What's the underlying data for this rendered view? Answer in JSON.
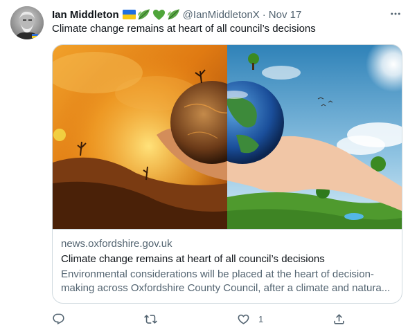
{
  "tweet": {
    "author_name": "Ian Middleton",
    "handle": "@IanMiddletonX",
    "separator": "·",
    "date": "Nov 17",
    "text": "Climate change remains at heart of all council’s decisions",
    "badge_icons": [
      "ukraine-flag-icon",
      "leaf-icon",
      "green-heart-icon",
      "leaf-icon"
    ]
  },
  "card": {
    "domain": "news.oxfordshire.gov.uk",
    "title": "Climate change remains at heart of all council’s decisions",
    "description": "Environmental considerations will be placed at the heart of decision-making across Oxfordshire County Council, after a climate and natura..."
  },
  "actions": {
    "reply_count": "",
    "retweet_count": "",
    "like_count": "1",
    "share_count": ""
  },
  "colors": {
    "text_primary": "#0f1419",
    "text_secondary": "#536471",
    "border": "#cfd9de"
  }
}
